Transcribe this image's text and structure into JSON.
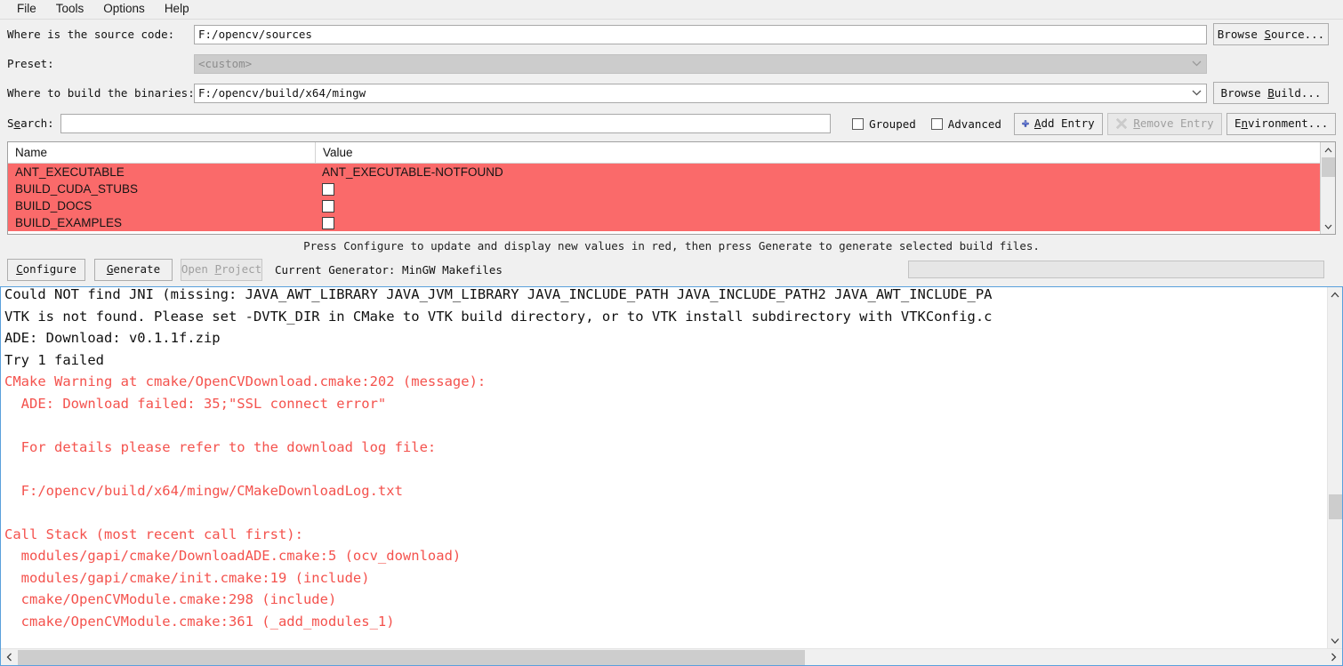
{
  "menu": {
    "items": [
      {
        "label": "File"
      },
      {
        "label": "Tools"
      },
      {
        "label": "Options"
      },
      {
        "label": "Help"
      }
    ]
  },
  "form": {
    "source_label": "Where is the source code:",
    "source_value": "F:/opencv/sources",
    "browse_source_label": "Browse Source...",
    "preset_label": "Preset:",
    "preset_value": "<custom>",
    "build_label": "Where to build the binaries:",
    "build_value": "F:/opencv/build/x64/mingw",
    "browse_build_label": "Browse Build...",
    "search_label": "Search:",
    "search_value": "",
    "search_placeholder": "",
    "grouped_label": "Grouped",
    "grouped_checked": false,
    "advanced_label": "Advanced",
    "advanced_checked": false,
    "add_entry_label": "Add Entry",
    "remove_entry_label": "Remove Entry",
    "environment_label": "Environment..."
  },
  "cache_table": {
    "columns": [
      "Name",
      "Value"
    ],
    "highlight_color": "#fa6a6a",
    "rows": [
      {
        "name": "ANT_EXECUTABLE",
        "value": "ANT_EXECUTABLE-NOTFOUND",
        "type": "text"
      },
      {
        "name": "BUILD_CUDA_STUBS",
        "value": "",
        "type": "checkbox",
        "checked": false
      },
      {
        "name": "BUILD_DOCS",
        "value": "",
        "type": "checkbox",
        "checked": false
      },
      {
        "name": "BUILD_EXAMPLES",
        "value": "",
        "type": "checkbox",
        "checked": false
      }
    ]
  },
  "hint": "Press Configure to update and display new values in red, then press Generate to generate selected build files.",
  "actions": {
    "configure_label": "Configure",
    "generate_label": "Generate",
    "open_project_label": "Open Project",
    "open_project_disabled": true,
    "current_generator": "Current Generator: MinGW Makefiles",
    "progress_percent": 0
  },
  "log": {
    "lines": [
      {
        "text": "Could NOT find JNI (missing: JAVA_AWT_LIBRARY JAVA_JVM_LIBRARY JAVA_INCLUDE_PATH JAVA_INCLUDE_PATH2 JAVA_AWT_INCLUDE_PA",
        "color": "black"
      },
      {
        "text": "VTK is not found. Please set -DVTK_DIR in CMake to VTK build directory, or to VTK install subdirectory with VTKConfig.c",
        "color": "black"
      },
      {
        "text": "ADE: Download: v0.1.1f.zip",
        "color": "black"
      },
      {
        "text": "Try 1 failed",
        "color": "black"
      },
      {
        "text": "CMake Warning at cmake/OpenCVDownload.cmake:202 (message):",
        "color": "red"
      },
      {
        "text": "  ADE: Download failed: 35;\"SSL connect error\"",
        "color": "red"
      },
      {
        "text": "",
        "color": "red"
      },
      {
        "text": "  For details please refer to the download log file:",
        "color": "red"
      },
      {
        "text": "",
        "color": "red"
      },
      {
        "text": "  F:/opencv/build/x64/mingw/CMakeDownloadLog.txt",
        "color": "red"
      },
      {
        "text": "",
        "color": "red"
      },
      {
        "text": "Call Stack (most recent call first):",
        "color": "red"
      },
      {
        "text": "  modules/gapi/cmake/DownloadADE.cmake:5 (ocv_download)",
        "color": "red"
      },
      {
        "text": "  modules/gapi/cmake/init.cmake:19 (include)",
        "color": "red"
      },
      {
        "text": "  cmake/OpenCVModule.cmake:298 (include)",
        "color": "red"
      },
      {
        "text": "  cmake/OpenCVModule.cmake:361 (_add_modules_1)",
        "color": "red"
      }
    ]
  },
  "colors": {
    "accent_red": "#f4524d",
    "row_highlight": "#fa6a6a",
    "window_bg": "#f0f0f0",
    "log_border": "#5aa0dc"
  }
}
